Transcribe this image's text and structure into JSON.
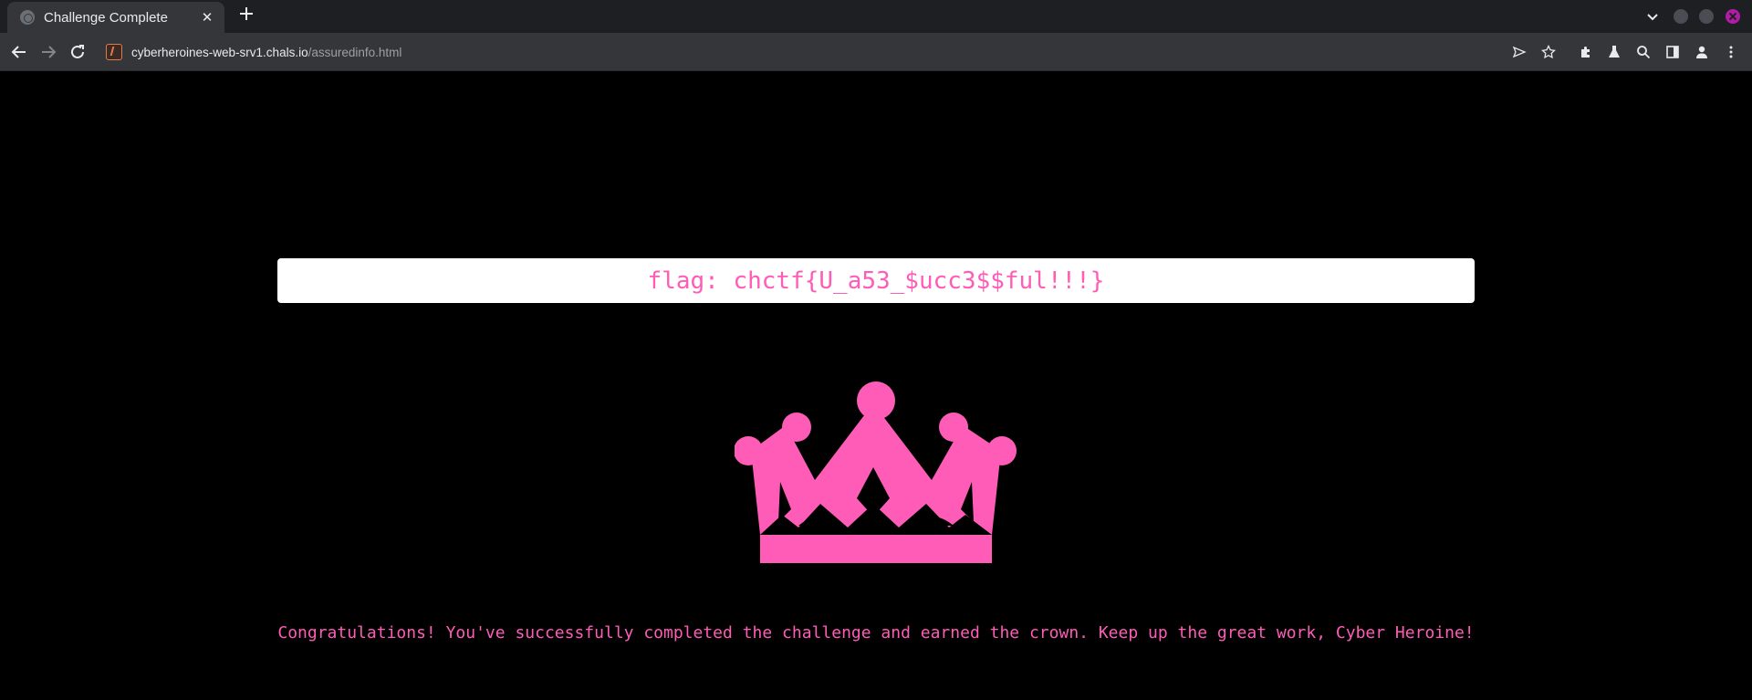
{
  "browser": {
    "tab_title": "Challenge Complete",
    "url_host": "cyberheroines-web-srv1.chals.io",
    "url_path": "/assuredinfo.html"
  },
  "page": {
    "flag": "flag: chctf{U_a53_$ucc3$$ful!!!}",
    "crown_icon": "crown-icon",
    "message": "Congratulations! You've successfully completed the challenge and earned the crown. Keep up the great work, Cyber Heroine!"
  },
  "colors": {
    "accent_pink": "#ff5cb8",
    "page_background": "#000000",
    "browser_chrome": "#35363a",
    "tab_strip": "#1e1f22"
  }
}
